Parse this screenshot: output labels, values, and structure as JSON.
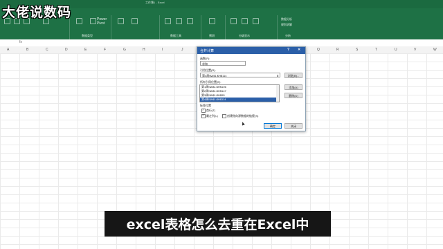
{
  "watermark": "大佬说数码",
  "app": {
    "title": "工作簿1 - Excel",
    "visible_tab": "Power Pivot",
    "group_labels": [
      "数据类型",
      "数据工具",
      "预测",
      "分级显示",
      "分析"
    ],
    "analysis_items": [
      "数据分析",
      "规划求解"
    ]
  },
  "columns": [
    "A",
    "B",
    "C",
    "D",
    "E",
    "F",
    "G",
    "H",
    "I",
    "J",
    "K",
    "L",
    "M",
    "N",
    "O",
    "P",
    "Q",
    "R",
    "S",
    "T",
    "U",
    "V",
    "W"
  ],
  "dialog": {
    "title": "合并计算",
    "function_label": "函数(F):",
    "function_value": "求和",
    "ref_label": "引用位置(R):",
    "ref_value": "第4周!$A$1:$H$114",
    "browse_label": "浏览(B)...",
    "all_refs_label": "所有引用位置(E):",
    "refs": [
      "第1周!$A$1:$H$106",
      "第2周!$A$1:$H$147",
      "第3周!$A$1:$H$95",
      "第4周!$A$1:$H$114"
    ],
    "selected_ref_index": 3,
    "add_label": "添加(A)",
    "delete_label": "删除(D)",
    "tag_position_label": "标签位置",
    "top_row_label": "首行(T)",
    "left_col_label": "最左列(L)",
    "link_source_label": "创建指向源数据的链接(S)",
    "ok_label": "确定",
    "close_label": "关闭"
  },
  "caption": "excel表格怎么去重在Excel中"
}
